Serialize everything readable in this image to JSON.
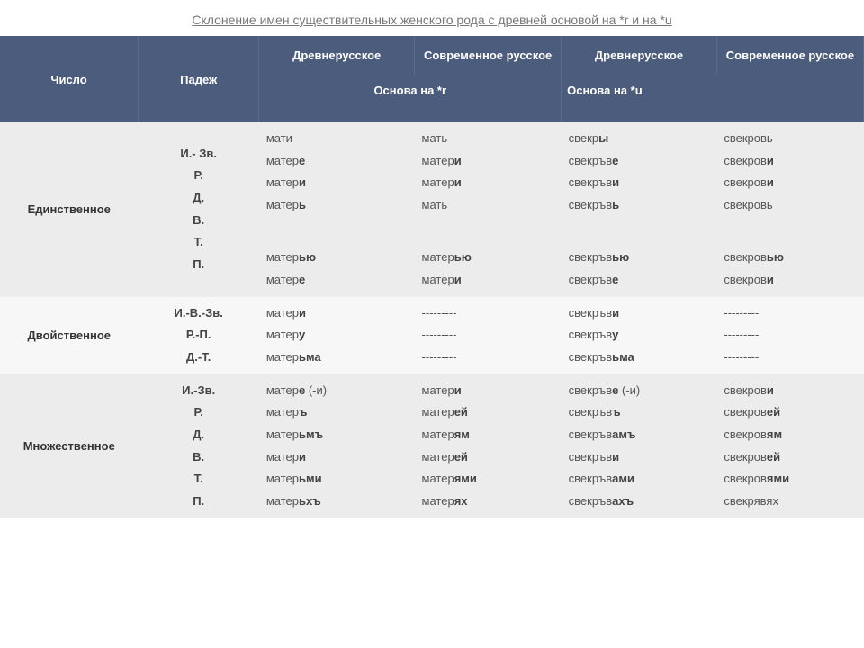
{
  "title": "Склонение имен существительных женского рода с древней основой на *r  и  на *u",
  "hdr": {
    "col_number": "Число",
    "col_case": "Падеж",
    "col_old1": "Древнерусское",
    "col_new1": "Современное русское",
    "col_old2": "Древнерусское",
    "col_new2": "Современное русское",
    "base_r": "Основа на *r",
    "base_u": "Основа на *u"
  },
  "rows": {
    "sg": {
      "name": "Единственное",
      "cases": "И.- Зв.\nР.\nД.\nВ.\nТ.\nП.",
      "c1": "мати\nматер<b>е</b>\nматер<b>и</b>\nматер<b>ь</b>\n<span class='gap'></span>\nматер<b>ью</b>\nматер<b>е</b>",
      "c2": "мать\nматер<b>и</b>\nматер<b>и</b>\nмать\n<span class='gap'></span>\nматер<b>ью</b>\nматер<b>и</b>",
      "c3": "свекр<b>ы</b>\nсвекръв<b>е</b>\nсвекръв<b>и</b>\nсвекръв<b>ь</b>\n<span class='gap'></span>\nсвекръв<b>ью</b>\nсвекръв<b>е</b>",
      "c4": "свекровь\nсвекров<b>и</b>\nсвекров<b>и</b>\nсвекровь\n<span class='gap'></span>\nсвекров<b>ью</b>\nсвекров<b>и</b>"
    },
    "du": {
      "name": "Двойственное",
      "cases": "И.-В.-Зв.\nР.-П.\nД.-Т.",
      "c1": "матер<b>и</b>\nматер<b>у</b>\nматер<b>ьма</b>",
      "c2": "---------\n---------\n---------",
      "c3": "свекръв<b>и</b>\nсвекръв<b>у</b>\nсвекръв<b>ьма</b>",
      "c4": "---------\n---------\n---------"
    },
    "pl": {
      "name": "Множественное",
      "cases": "И.-Зв.\nР.\nД.\nВ.\nТ.\nП.",
      "c1": "матер<b>е</b> (-и)\n матер<b>ъ</b>\nматер<b>ьмъ</b>\nматер<b>и</b>\n матер<b>ьми</b>\nматер<b>ьхъ</b>",
      "c2": "матер<b>и</b>\n матер<b>ей</b>\nматер<b>ям</b>\nматер<b>ей</b>\n матер<b>ями</b>\nматер<b>ях</b>",
      "c3": "свекръв<b>е</b> (-и)\nсвекръв<b>ъ</b>\nсвекръв<b>амъ</b>\nсвекръв<b>и</b>\nсвекръв<b>ами</b>\nсвекръв<b>ахъ</b>",
      "c4": "свекров<b>и</b>\nсвекров<b>ей</b>\nсвекров<b>ям</b>\nсвекров<b>ей</b>\nсвекров<b>ями</b>\nсвекрявях"
    }
  }
}
